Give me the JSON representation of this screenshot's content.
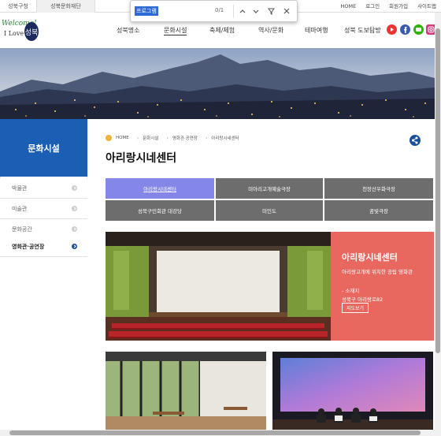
{
  "top_bar": {
    "tabs": [
      "성북구청",
      "성북문화재단"
    ],
    "links": [
      "HOME",
      "로그인",
      "회원가입",
      "사이트맵"
    ]
  },
  "find_bar": {
    "query": "프로그램",
    "count": "0/1"
  },
  "logo": {
    "line1": "Welcome!",
    "line2": "I Love",
    "mark": "성북"
  },
  "nav": {
    "items": [
      "성북명소",
      "문화시설",
      "축제/체험",
      "역사/문화",
      "테마여행",
      "성북 도보탐방"
    ],
    "active": "문화시설"
  },
  "social_icons": [
    "youtube-icon",
    "facebook-icon",
    "naver-blog-icon",
    "instagram-icon"
  ],
  "sidebar": {
    "title": "문화시설",
    "items": [
      "박물관",
      "미술관",
      "문화공간",
      "영화관·공연장"
    ],
    "active_index": 3
  },
  "breadcrumb": [
    "HOME",
    "문화시설",
    "영화관·공연장",
    "아리랑시네센터"
  ],
  "page_title": "아리랑시네센터",
  "tabs": {
    "items": [
      "아리랑시네센터",
      "미아리고개예술극장",
      "천장산우화극장",
      "성북구민회관 대강당",
      "미인도",
      "꿈빛극장"
    ],
    "active_index": 0
  },
  "feature": {
    "title": "아리랑시네센터",
    "subtitle": "아리랑고개에 위치한 공립 영화관",
    "location_label": "- 소재지",
    "address": "성북구 아리랑로82",
    "map_button": "지도보기"
  },
  "colors": {
    "accent_blue": "#1a5fb4",
    "active_tab": "#8486e8",
    "tab_gray": "#6d6d6d",
    "feature_red": "#e8675f"
  }
}
